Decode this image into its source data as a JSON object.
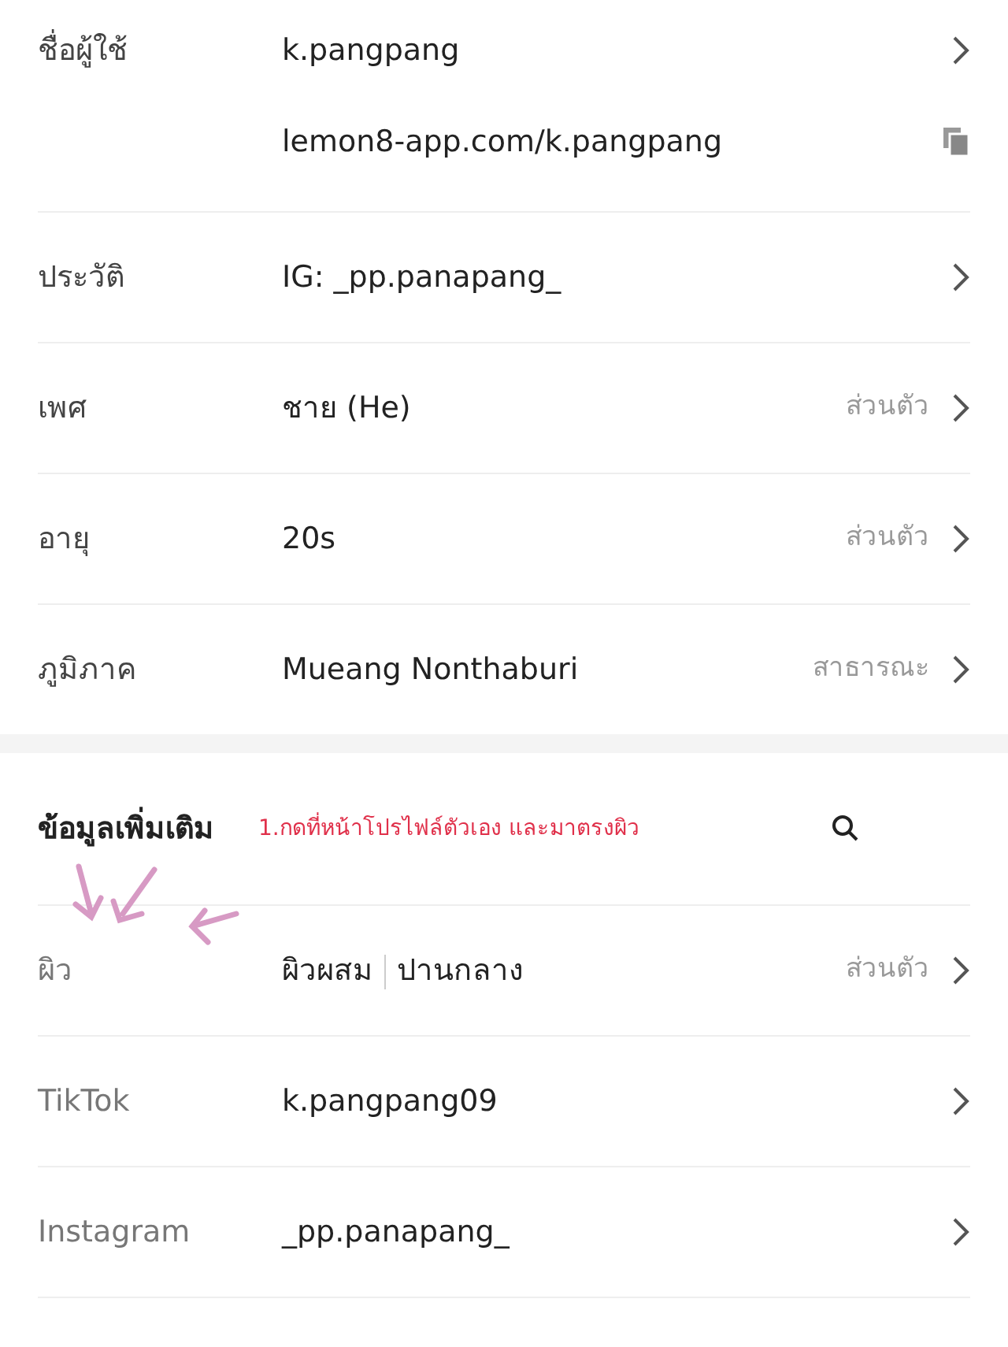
{
  "basic_rows": [
    {
      "label": "ชื่อผู้ใช้",
      "value": "k.pangpang",
      "link": "lemon8-app.com/k.pangpang"
    },
    {
      "label": "ประวัติ",
      "value": "IG: _pp.panapang_"
    },
    {
      "label": "เพศ",
      "value": "ชาย (He)",
      "privacy": "ส่วนตัว"
    },
    {
      "label": "อายุ",
      "value": "20s",
      "privacy": "ส่วนตัว"
    },
    {
      "label": "ภูมิภาค",
      "value": "Mueang Nonthaburi",
      "privacy": "สาธารณะ"
    }
  ],
  "extra_section": {
    "title": "ข้อมูลเพิ่มเติม",
    "annotation": "1.กดที่หน้าโปรไฟล์ตัวเอง และมาตรงผิว"
  },
  "extra_rows": [
    {
      "label": "ผิว",
      "values": [
        "ผิวผสม",
        "ปานกลาง"
      ],
      "privacy": "ส่วนตัว"
    },
    {
      "label": "TikTok",
      "values": [
        "k.pangpang09"
      ]
    },
    {
      "label": "Instagram",
      "values": [
        "_pp.panapang_"
      ]
    }
  ]
}
